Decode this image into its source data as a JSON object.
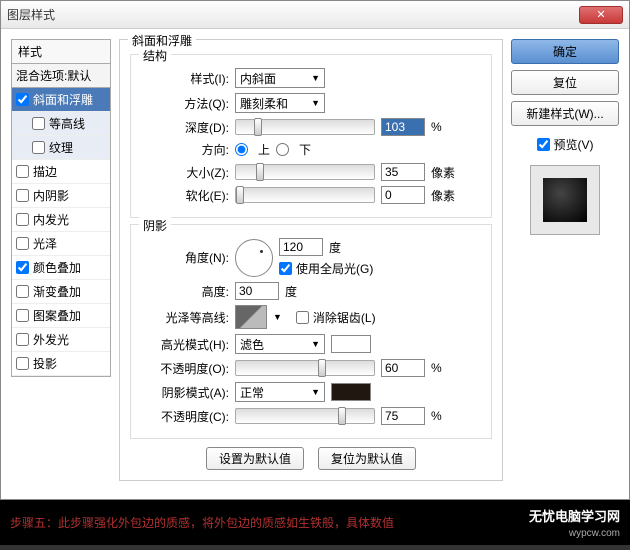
{
  "window": {
    "title": "图层样式"
  },
  "left": {
    "header": "样式",
    "blend": "混合选项:默认",
    "items": [
      {
        "label": "斜面和浮雕",
        "checked": true,
        "selected": true
      },
      {
        "label": "等高线",
        "checked": false,
        "sub": true
      },
      {
        "label": "纹理",
        "checked": false,
        "sub": true
      },
      {
        "label": "描边",
        "checked": false
      },
      {
        "label": "内阴影",
        "checked": false
      },
      {
        "label": "内发光",
        "checked": false
      },
      {
        "label": "光泽",
        "checked": false
      },
      {
        "label": "颜色叠加",
        "checked": true
      },
      {
        "label": "渐变叠加",
        "checked": false
      },
      {
        "label": "图案叠加",
        "checked": false
      },
      {
        "label": "外发光",
        "checked": false
      },
      {
        "label": "投影",
        "checked": false
      }
    ]
  },
  "center": {
    "section_title": "斜面和浮雕",
    "structure": {
      "legend": "结构",
      "style_label": "样式(I):",
      "style_value": "内斜面",
      "method_label": "方法(Q):",
      "method_value": "雕刻柔和",
      "depth_label": "深度(D):",
      "depth_value": "103",
      "depth_unit": "%",
      "direction_label": "方向:",
      "dir_up": "上",
      "dir_down": "下",
      "size_label": "大小(Z):",
      "size_value": "35",
      "size_unit": "像素",
      "soften_label": "软化(E):",
      "soften_value": "0",
      "soften_unit": "像素"
    },
    "shadow": {
      "legend": "阴影",
      "angle_label": "角度(N):",
      "angle_value": "120",
      "angle_unit": "度",
      "global_label": "使用全局光(G)",
      "altitude_label": "高度:",
      "altitude_value": "30",
      "altitude_unit": "度",
      "gloss_label": "光泽等高线:",
      "antialias_label": "消除锯齿(L)",
      "hl_mode_label": "高光模式(H):",
      "hl_mode_value": "滤色",
      "hl_opacity_label": "不透明度(O):",
      "hl_opacity_value": "60",
      "hl_opacity_unit": "%",
      "sh_mode_label": "阴影模式(A):",
      "sh_mode_value": "正常",
      "sh_opacity_label": "不透明度(C):",
      "sh_opacity_value": "75",
      "sh_opacity_unit": "%"
    },
    "defaults": {
      "set": "设置为默认值",
      "reset": "复位为默认值"
    }
  },
  "right": {
    "ok": "确定",
    "cancel": "复位",
    "newstyle": "新建样式(W)...",
    "preview_label": "预览(V)"
  },
  "footer": {
    "hint": "步骤五：此步骤强化外包边的质感，将外包边的质感如生铁般，具体数值",
    "brand": "无忧电脑学习网",
    "brand_sub": "wypcw.com"
  }
}
